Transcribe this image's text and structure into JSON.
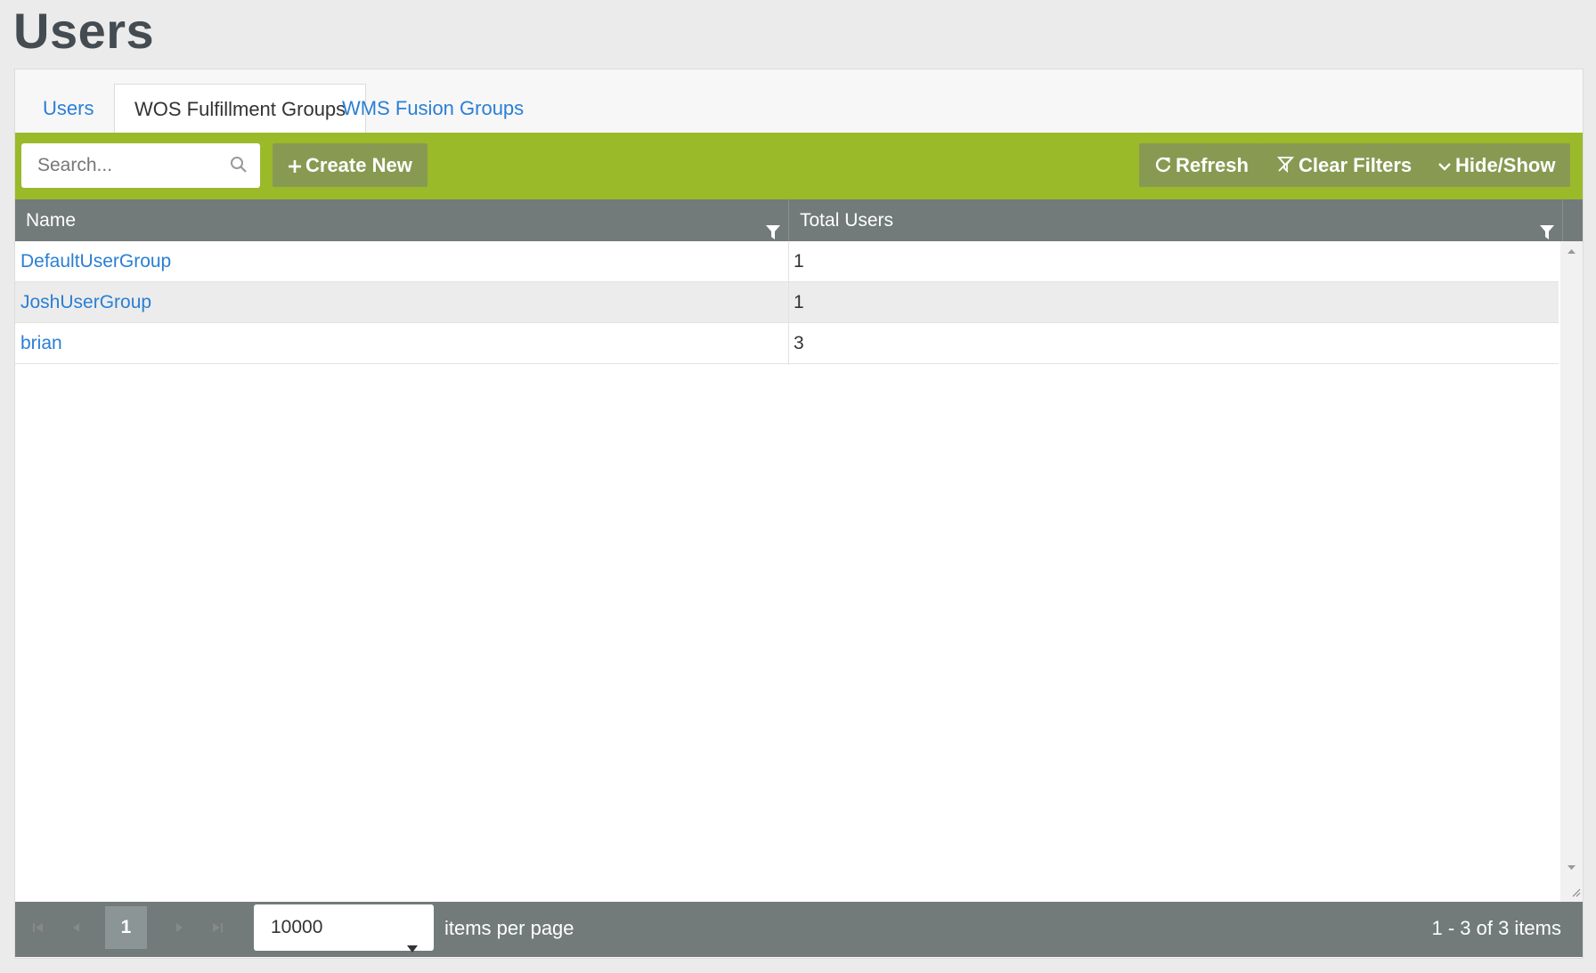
{
  "page": {
    "title": "Users"
  },
  "tabs": [
    {
      "label": "Users",
      "active": false
    },
    {
      "label": "WOS Fulfillment Groups",
      "active": true
    },
    {
      "label": "WMS Fusion Groups",
      "active": false
    }
  ],
  "toolbar": {
    "search_placeholder": "Search...",
    "create_label": "Create New",
    "refresh_label": "Refresh",
    "clear_filters_label": "Clear Filters",
    "hide_show_label": "Hide/Show"
  },
  "grid": {
    "columns": [
      "Name",
      "Total Users"
    ],
    "rows": [
      {
        "name": "DefaultUserGroup",
        "total": "1"
      },
      {
        "name": "JoshUserGroup",
        "total": "1"
      },
      {
        "name": "brian",
        "total": "3"
      }
    ]
  },
  "pager": {
    "current_page": "1",
    "page_size": "10000",
    "items_per_page_label": "items per page",
    "info": "1 - 3 of 3 items"
  },
  "colors": {
    "toolbar": "#9aba2a",
    "button": "#889a52",
    "header": "#737a7a",
    "link": "#2a7fd4"
  },
  "icons": [
    "search-icon",
    "plus-icon",
    "refresh-icon",
    "clear-filter-icon",
    "chevron-down-icon",
    "filter-icon",
    "first-page-icon",
    "prev-page-icon",
    "next-page-icon",
    "last-page-icon",
    "dropdown-caret-icon"
  ]
}
